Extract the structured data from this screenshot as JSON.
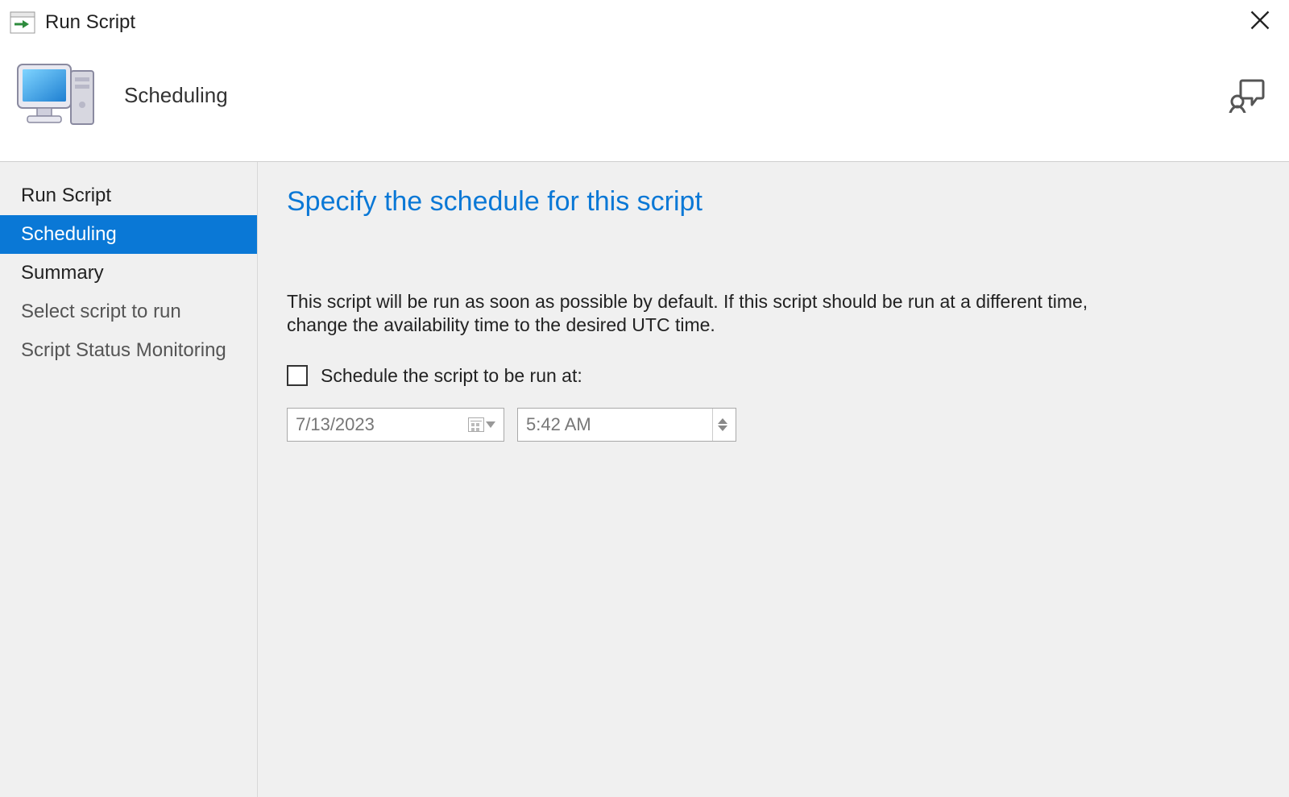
{
  "window": {
    "title": "Run Script"
  },
  "header": {
    "title": "Scheduling"
  },
  "sidebar": {
    "items": [
      {
        "label": "Run Script",
        "selected": false,
        "secondary": false
      },
      {
        "label": "Scheduling",
        "selected": true,
        "secondary": false
      },
      {
        "label": "Summary",
        "selected": false,
        "secondary": false
      },
      {
        "label": "Select script to run",
        "selected": false,
        "secondary": true
      },
      {
        "label": "Script Status Monitoring",
        "selected": false,
        "secondary": true
      }
    ]
  },
  "main": {
    "title": "Specify the schedule for this script",
    "description": "This script will be run as soon as possible by default. If this script should be run at a different time, change the availability time to the desired UTC time.",
    "checkbox_label": "Schedule the script to be run at:",
    "checkbox_checked": false,
    "date_value": "7/13/2023",
    "time_value": "5:42 AM"
  }
}
